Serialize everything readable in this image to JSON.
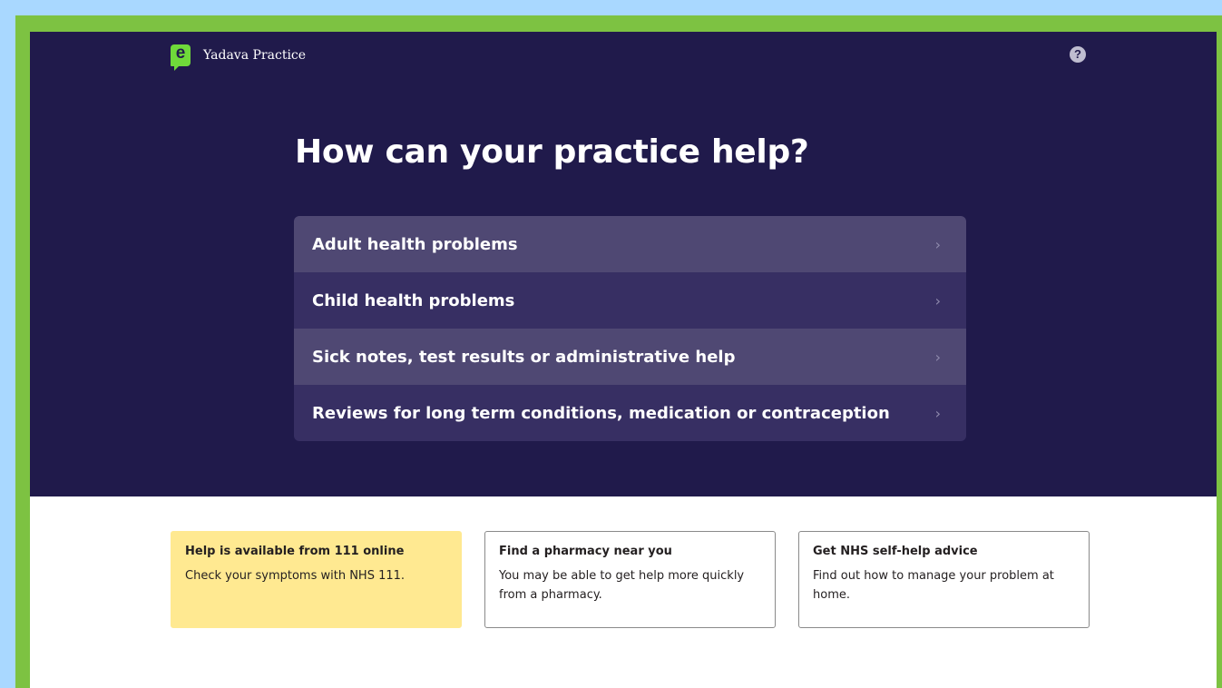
{
  "header": {
    "logo_letter": "e",
    "practice_name": "Yadava Practice",
    "help_icon": "?"
  },
  "hero": {
    "title": "How can your practice help?"
  },
  "menu": {
    "items": [
      {
        "label": "Adult health problems"
      },
      {
        "label": "Child health problems"
      },
      {
        "label": "Sick notes, test results or administrative help"
      },
      {
        "label": "Reviews for long term conditions, medication or contraception"
      }
    ],
    "chevron": "›"
  },
  "cards": [
    {
      "title": "Help is available from 111 online",
      "text": "Check your symptoms with NHS 111."
    },
    {
      "title": "Find a pharmacy near you",
      "text": "You may be able to get help more quickly from a pharmacy."
    },
    {
      "title": "Get NHS self-help advice",
      "text": "Find out how to manage your problem at home."
    }
  ],
  "colors": {
    "hero_bg": "#201a4b",
    "accent_green": "#6fd93a",
    "card_highlight": "#ffe991"
  }
}
